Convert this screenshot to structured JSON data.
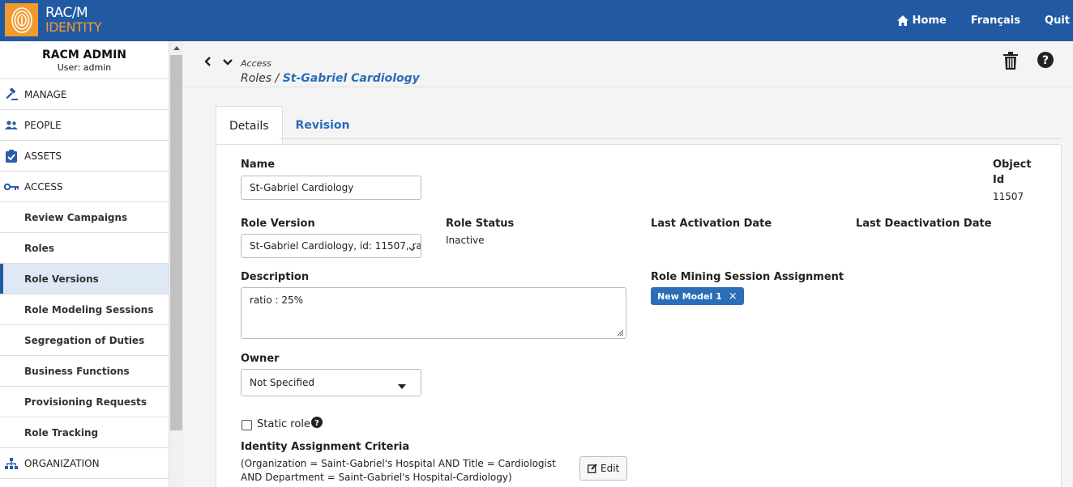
{
  "app": {
    "logo_line1": "RAC/M",
    "logo_line2": "IDENTITY",
    "nav": {
      "home": "Home",
      "language": "Français",
      "quit": "Quit"
    }
  },
  "sidebar": {
    "title": "RACM ADMIN",
    "user": "User: admin",
    "items": [
      {
        "label": "MANAGE",
        "icon": "gavel-icon",
        "level": "top"
      },
      {
        "label": "PEOPLE",
        "icon": "people-icon",
        "level": "top"
      },
      {
        "label": "ASSETS",
        "icon": "clipboard-check-icon",
        "level": "top"
      },
      {
        "label": "ACCESS",
        "icon": "key-icon",
        "level": "top"
      },
      {
        "label": "Review Campaigns",
        "level": "sub"
      },
      {
        "label": "Roles",
        "level": "sub"
      },
      {
        "label": "Role Versions",
        "level": "sub",
        "active": true
      },
      {
        "label": "Role Modeling Sessions",
        "level": "sub"
      },
      {
        "label": "Segregation of Duties",
        "level": "sub"
      },
      {
        "label": "Business Functions",
        "level": "sub"
      },
      {
        "label": "Provisioning Requests",
        "level": "sub"
      },
      {
        "label": "Role Tracking",
        "level": "sub"
      },
      {
        "label": "ORGANIZATION",
        "icon": "sitemap-icon",
        "level": "top"
      }
    ]
  },
  "header": {
    "breadcrumb_small": "Access",
    "breadcrumb_parent": "Roles",
    "breadcrumb_sep": " / ",
    "breadcrumb_current": "St-Gabriel Cardiology"
  },
  "tabs": [
    {
      "label": "Details",
      "active": true
    },
    {
      "label": "Revision",
      "active": false
    }
  ],
  "form": {
    "name_label": "Name",
    "name_value": "St-Gabriel Cardiology",
    "object_id_label_1": "Object",
    "object_id_label_2": "Id",
    "object_id_value": "11507",
    "role_version_label": "Role Version",
    "role_version_value": "St-Gabriel Cardiology, id: 11507, ra",
    "role_status_label": "Role Status",
    "role_status_value": "Inactive",
    "last_activation_label": "Last Activation Date",
    "last_deactivation_label": "Last Deactivation Date",
    "description_label": "Description",
    "description_value": "ratio : 25%",
    "mining_label": "Role Mining Session Assignment",
    "mining_tag": "New Model 1",
    "mining_tag_close": "×",
    "owner_label": "Owner",
    "owner_value": "Not Specified",
    "static_role_label": "Static role",
    "criteria_label": "Identity Assignment Criteria",
    "criteria_line1": "(Organization = Saint-Gabriel's Hospital AND Title = Cardiologist",
    "criteria_line2": "AND Department = Saint-Gabriel's Hospital-Cardiology)",
    "edit_label": "Edit"
  },
  "colors": {
    "topbar": "#2259a3",
    "accent": "#2a6db8",
    "logo": "#f29a2e"
  }
}
